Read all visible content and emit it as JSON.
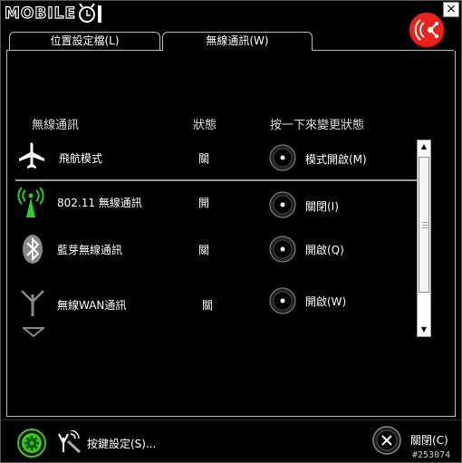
{
  "window": {
    "brand": "MOBILE",
    "close_glyph": "×"
  },
  "tabs": [
    {
      "label": "位置設定檔(L)",
      "active": false
    },
    {
      "label": "無線通訊(W)",
      "active": true
    }
  ],
  "table": {
    "headers": {
      "name": "無線通訊",
      "status": "狀態",
      "action": "按一下來變更狀態"
    },
    "rows": [
      {
        "icon": "airplane-icon",
        "name": "飛航模式",
        "status": "關",
        "action": "模式開啟(M)"
      },
      {
        "icon": "wifi-antenna-icon",
        "name": "802.11 無線通訊",
        "status": "開",
        "action": "關閉(I)"
      },
      {
        "icon": "bluetooth-icon",
        "name": "藍芽無線通訊",
        "status": "關",
        "action": "開啟(Q)"
      },
      {
        "icon": "wan-antenna-icon",
        "name": "無線WAN通訊",
        "status": "關",
        "action": "開啟(W)"
      }
    ]
  },
  "footer": {
    "keys_label": "按鍵設定(S)...",
    "close_label": "關閉(C)"
  },
  "watermark": "#253074",
  "colors": {
    "accent_red": "#e8231c",
    "accent_green": "#3ec41c",
    "wifi_green": "#2ecc2e"
  }
}
